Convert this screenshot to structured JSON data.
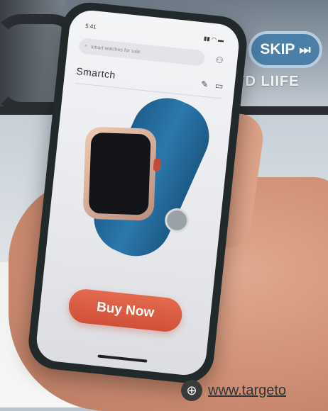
{
  "overlay": {
    "headline": "ETD LIIFE",
    "skip_label": "SKIP"
  },
  "phone": {
    "status_left": "5:41",
    "search_placeholder": "smart watches for sale",
    "app_title": "Smartch",
    "buy_label": "Buy Now"
  },
  "footer": {
    "url_text": "www.targeto"
  },
  "colors": {
    "accent": "#d9573f",
    "skip_bg": "#4b7fa8",
    "strap": "#2b78ad"
  },
  "icons": {
    "skip": "skip-forward-icon",
    "globe": "globe-icon",
    "user": "user-icon",
    "edit": "edit-icon",
    "menu": "menu-icon",
    "search": "search-icon"
  }
}
